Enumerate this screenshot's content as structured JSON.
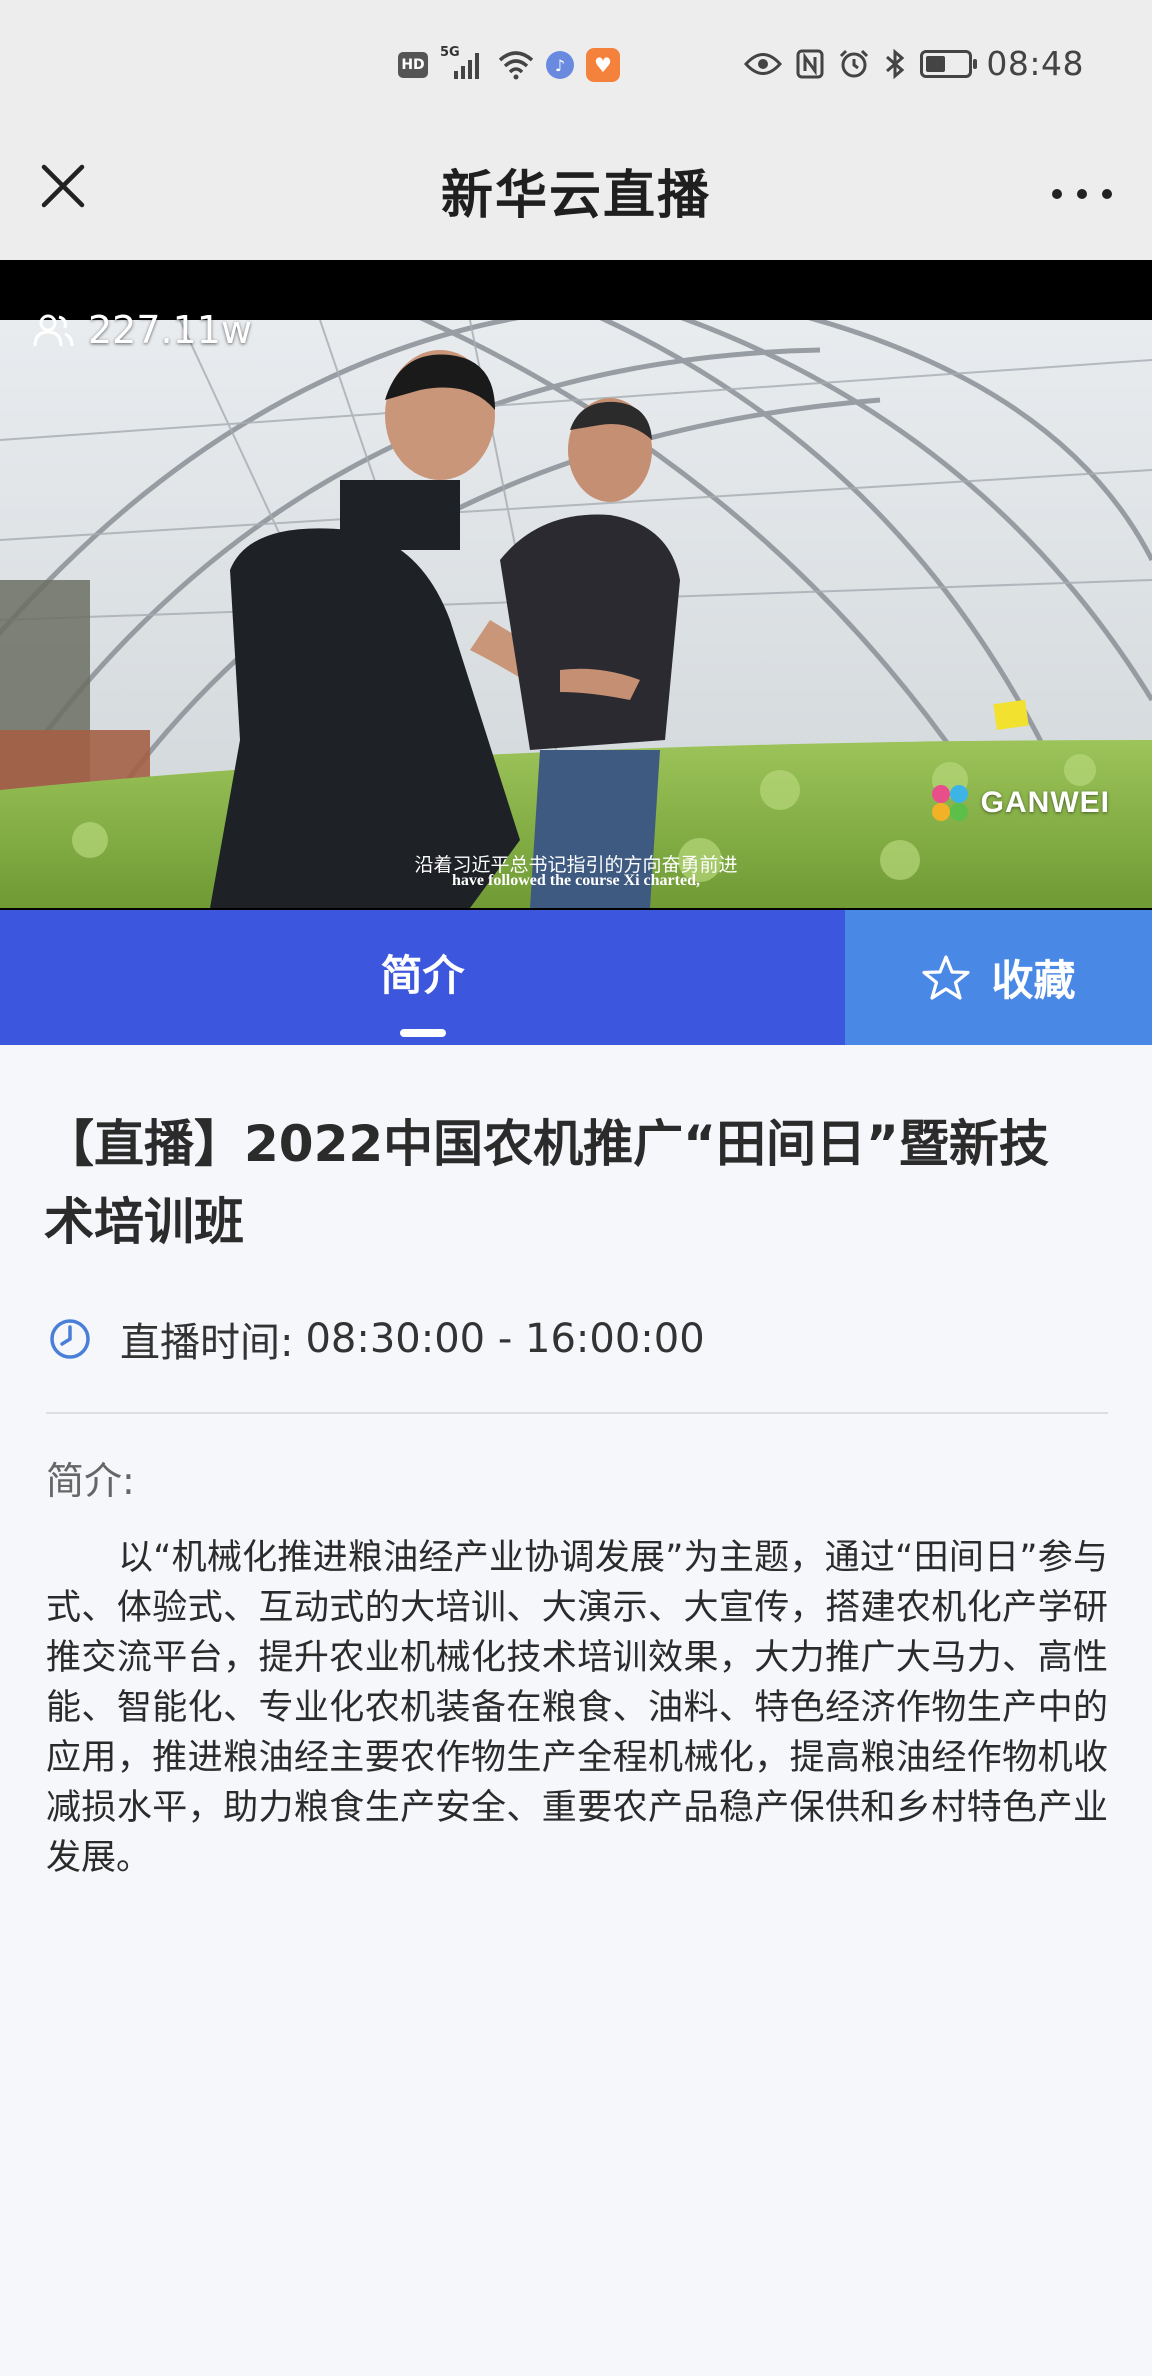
{
  "status_bar": {
    "hd_label": "HD",
    "network_label": "5G",
    "time": "08:48"
  },
  "nav": {
    "title": "新华云直播"
  },
  "video": {
    "viewer_count": "227.11w",
    "logo_text": "GANWEI",
    "subtitle_cn": "沿着习近平总书记指引的方向奋勇前进",
    "subtitle_en": "have followed the course Xi charted,"
  },
  "tabs": {
    "intro_label": "简介",
    "favorite_label": "收藏"
  },
  "content": {
    "title": "【直播】2022中国农机推广“田间日”暨新技术培训班",
    "time_label": "直播时间:",
    "time_value": "08:30:00 - 16:00:00",
    "desc_label": "简介:",
    "desc_text": "以“机械化推进粮油经产业协调发展”为主题，通过“田间日”参与式、体验式、互动式的大培训、大演示、大宣传，搭建农机化产学研推交流平台，提升农业机械化技术培训效果，大力推广大马力、高性能、智能化、专业化农机装备在粮食、油料、特色经济作物生产中的应用，推进粮油经主要农作物生产全程机械化，提高粮油经作物机收减损水平，助力粮食生产安全、重要农产品稳产保供和乡村特色产业发展。"
  },
  "colors": {
    "tab_active_bg": "#3d56de",
    "tab_fav_bg": "#4a88e6",
    "clock_icon": "#4a7fd8"
  }
}
